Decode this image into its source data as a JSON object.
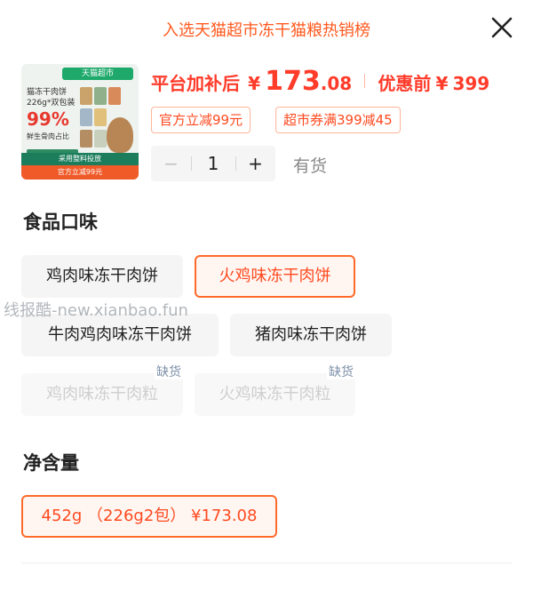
{
  "header": {
    "title": "入选天猫超市冻干猫粮热销榜",
    "close_icon": "close-icon"
  },
  "product": {
    "thumbnail": {
      "brand": "天猫超市",
      "line1": "猫冻干肉饼",
      "line2": "226g*双包装",
      "pct": "99%",
      "line3": "鲜生骨肉占比",
      "bottom1": "采用整料投放",
      "bottom2": "官方立减99元"
    },
    "price_label": "平台加补后",
    "currency": "¥",
    "price_int": "173",
    "price_dec": ".08",
    "orig_label": "优惠前",
    "orig_price": "399",
    "coupons": [
      "官方立减99元",
      "超市券满399减45"
    ],
    "quantity": "1",
    "minus": "−",
    "plus": "+",
    "stock_status": "有货"
  },
  "flavor": {
    "title": "食品口味",
    "options": [
      {
        "label": "鸡肉味冻干肉饼",
        "state": "normal"
      },
      {
        "label": "火鸡味冻干肉饼",
        "state": "selected"
      },
      {
        "label": "牛肉鸡肉味冻干肉饼",
        "state": "normal"
      },
      {
        "label": "猪肉味冻干肉饼",
        "state": "normal"
      },
      {
        "label": "鸡肉味冻干肉粒",
        "state": "disabled",
        "badge": "缺货"
      },
      {
        "label": "火鸡味冻干肉粒",
        "state": "disabled",
        "badge": "缺货"
      }
    ]
  },
  "weight": {
    "title": "净含量",
    "options": [
      {
        "label": "452g （226g2包） ¥173.08",
        "state": "selected"
      }
    ]
  },
  "watermark": "线报酷-new.xianbao.fun",
  "colors": {
    "accent": "#ff5a1f",
    "price": "#ff3b2a",
    "chip_bg": "#f5f5f5",
    "oos_badge": "#7c8fa8"
  }
}
